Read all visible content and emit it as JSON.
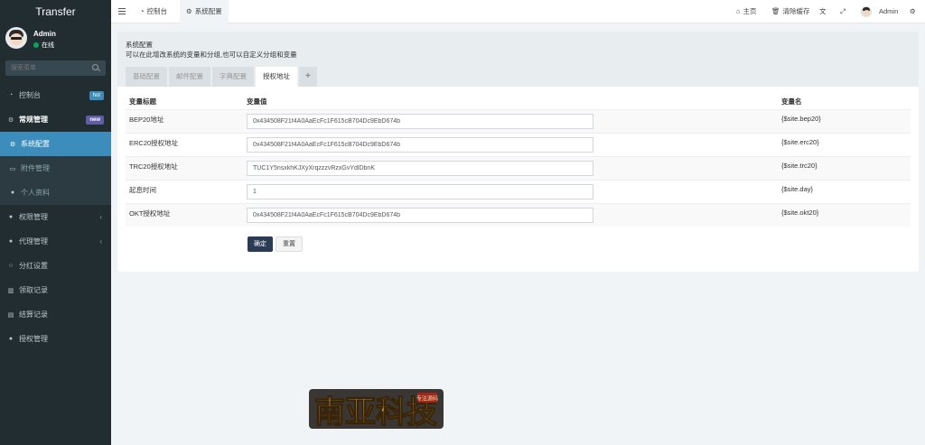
{
  "sidebar": {
    "brand": "Transfer",
    "user": {
      "name": "Admin",
      "status": "在线"
    },
    "search_placeholder": "搜索菜单",
    "items": [
      {
        "label": "控制台",
        "badge": "hot",
        "icon": "dashboard-icon"
      },
      {
        "label": "常规管理",
        "badge": "new",
        "icon": "cogs-icon"
      },
      {
        "label": "系统配置",
        "icon": "cog-icon"
      },
      {
        "label": "附件管理",
        "icon": "file-icon"
      },
      {
        "label": "个人资料",
        "icon": "user-icon"
      },
      {
        "label": "权限管理",
        "icon": "group-icon"
      },
      {
        "label": "代理管理",
        "icon": "users-icon"
      },
      {
        "label": "分红设置",
        "icon": "circle-icon"
      },
      {
        "label": "领取记录",
        "icon": "bank-icon"
      },
      {
        "label": "结算记录",
        "icon": "list-icon"
      },
      {
        "label": "授权管理",
        "icon": "users-icon"
      }
    ]
  },
  "topbar": {
    "tabs": [
      {
        "label": "控制台"
      },
      {
        "label": "系统配置"
      }
    ],
    "right": {
      "home": "主页",
      "clear_cache": "清除缓存",
      "user": "Admin"
    }
  },
  "main": {
    "title": "系统配置",
    "description": "可以在此增改系统的变量和分组,也可以自定义分组和变量",
    "tabs": [
      "基础配置",
      "邮件配置",
      "字典配置",
      "授权地址",
      "+"
    ],
    "columns": [
      "变量标题",
      "变量值",
      "变量名"
    ],
    "rows": [
      {
        "title": "BEP20地址",
        "value": "0x434508F21f4A0AaEcFc1F615cB704Dc9EbD674b",
        "name": "{$site.bep20}"
      },
      {
        "title": "ERC20授权地址",
        "value": "0x434508F21f4A0AaEcFc1F615cB704Dc9EbD674b",
        "name": "{$site.erc20}"
      },
      {
        "title": "TRC20授权地址",
        "value": "TUC1Y5nsxkhKJXyXrqzzzvRzxGvYdlDbnK",
        "name": "{$site.trc20}"
      },
      {
        "title": "起息时间",
        "value": "1",
        "name": "{$site.day}"
      },
      {
        "title": "OKT授权地址",
        "value": "0x434508F21f4A0AaEcFc1F615cB704Dc9EbD674b",
        "name": "{$site.okt20}"
      }
    ],
    "submit": "确定",
    "reset": "重置"
  },
  "watermark": {
    "text": "南亚科技",
    "sub": "专注源码"
  },
  "colors": {
    "sidebar": "#222d32",
    "active": "#3c8dbc",
    "primary_button": "#2c3b55"
  }
}
